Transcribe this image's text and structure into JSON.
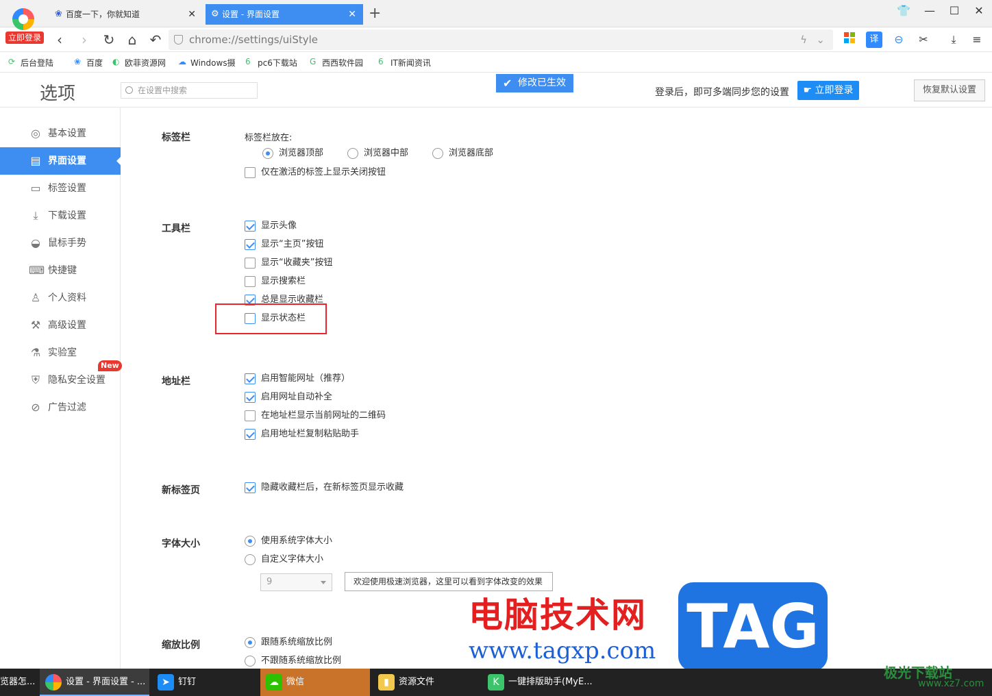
{
  "browser": {
    "login_badge": "立即登录",
    "tabs": [
      {
        "label": "百度一下，你就知道",
        "icon": "paw-icon"
      },
      {
        "label": "设置 - 界面设置",
        "icon": "gear-icon"
      }
    ],
    "url": "chrome://settings/uiStyle"
  },
  "bookmarks": [
    {
      "label": "后台登陆"
    },
    {
      "label": "百度"
    },
    {
      "label": "欧菲资源网"
    },
    {
      "label": "Windows摄"
    },
    {
      "label": "pc6下载站"
    },
    {
      "label": "西西软件园"
    },
    {
      "label": "IT新闻资讯"
    }
  ],
  "header": {
    "title": "选项",
    "search_placeholder": "在设置中搜索",
    "toast": "修改已生效",
    "sync_message": "登录后，即可多端同步您的设置",
    "login_button": "立即登录",
    "reset_button": "恢复默认设置"
  },
  "sidebar": {
    "items": [
      {
        "label": "基本设置",
        "icon": "circle-gear-icon"
      },
      {
        "label": "界面设置",
        "icon": "window-icon",
        "active": true
      },
      {
        "label": "标签设置",
        "icon": "tab-icon"
      },
      {
        "label": "下载设置",
        "icon": "download-icon"
      },
      {
        "label": "鼠标手势",
        "icon": "mouse-icon"
      },
      {
        "label": "快捷键",
        "icon": "keyboard-icon"
      },
      {
        "label": "个人资料",
        "icon": "person-icon"
      },
      {
        "label": "高级设置",
        "icon": "wrench-icon"
      },
      {
        "label": "实验室",
        "icon": "flask-icon"
      },
      {
        "label": "隐私安全设置",
        "icon": "shield-icon"
      },
      {
        "label": "广告过滤",
        "icon": "block-icon"
      }
    ],
    "new_badge": "New"
  },
  "sections": {
    "tabbar": {
      "title": "标签栏",
      "position_label": "标签栏放在:",
      "positions": [
        "浏览器顶部",
        "浏览器中部",
        "浏览器底部"
      ],
      "selected_position": "浏览器顶部",
      "close_btn_only_active": {
        "label": "仅在激活的标签上显示关闭按钮",
        "checked": false
      }
    },
    "toolbar": {
      "title": "工具栏",
      "options": [
        {
          "label": "显示头像",
          "checked": true
        },
        {
          "label": "显示“主页”按钮",
          "checked": true
        },
        {
          "label": "显示“收藏夹”按钮",
          "checked": false
        },
        {
          "label": "显示搜索栏",
          "checked": false
        },
        {
          "label": "总是显示收藏栏",
          "checked": true
        },
        {
          "label": "显示状态栏",
          "checked": false
        }
      ]
    },
    "addressbar": {
      "title": "地址栏",
      "options": [
        {
          "label": "启用智能网址（推荐）",
          "checked": true
        },
        {
          "label": "启用网址自动补全",
          "checked": true
        },
        {
          "label": "在地址栏显示当前网址的二维码",
          "checked": false
        },
        {
          "label": "启用地址栏复制粘贴助手",
          "checked": true
        }
      ]
    },
    "newtab": {
      "title": "新标签页",
      "option": {
        "label": "隐藏收藏栏后，在新标签页显示收藏",
        "checked": true
      }
    },
    "fontsize": {
      "title": "字体大小",
      "options": [
        "使用系统字体大小",
        "自定义字体大小"
      ],
      "selected": "使用系统字体大小",
      "size_value": "9",
      "preview_text": "欢迎使用极速浏览器，这里可以看到字体改变的效果"
    },
    "zoom": {
      "title": "缩放比例",
      "options": [
        "跟随系统缩放比例",
        "不跟随系统缩放比例"
      ],
      "selected": "跟随系统缩放比例"
    }
  },
  "watermark": {
    "cn": "电脑技术网",
    "url": "www.tagxp.com",
    "tag": "TAG",
    "corner": "极光下载站",
    "corner_url": "www.xz7.com"
  },
  "taskbar": {
    "items": [
      {
        "label": "览器怎..."
      },
      {
        "label": "设置 - 界面设置 - ...",
        "active": true
      },
      {
        "label": "钉钉"
      },
      {
        "label": "微信"
      },
      {
        "label": "资源文件"
      },
      {
        "label": "一键排版助手(MyE..."
      }
    ]
  },
  "colors": {
    "accent": "#3d8ef0",
    "highlight": "#e8262a",
    "login": "#1d8df5"
  }
}
